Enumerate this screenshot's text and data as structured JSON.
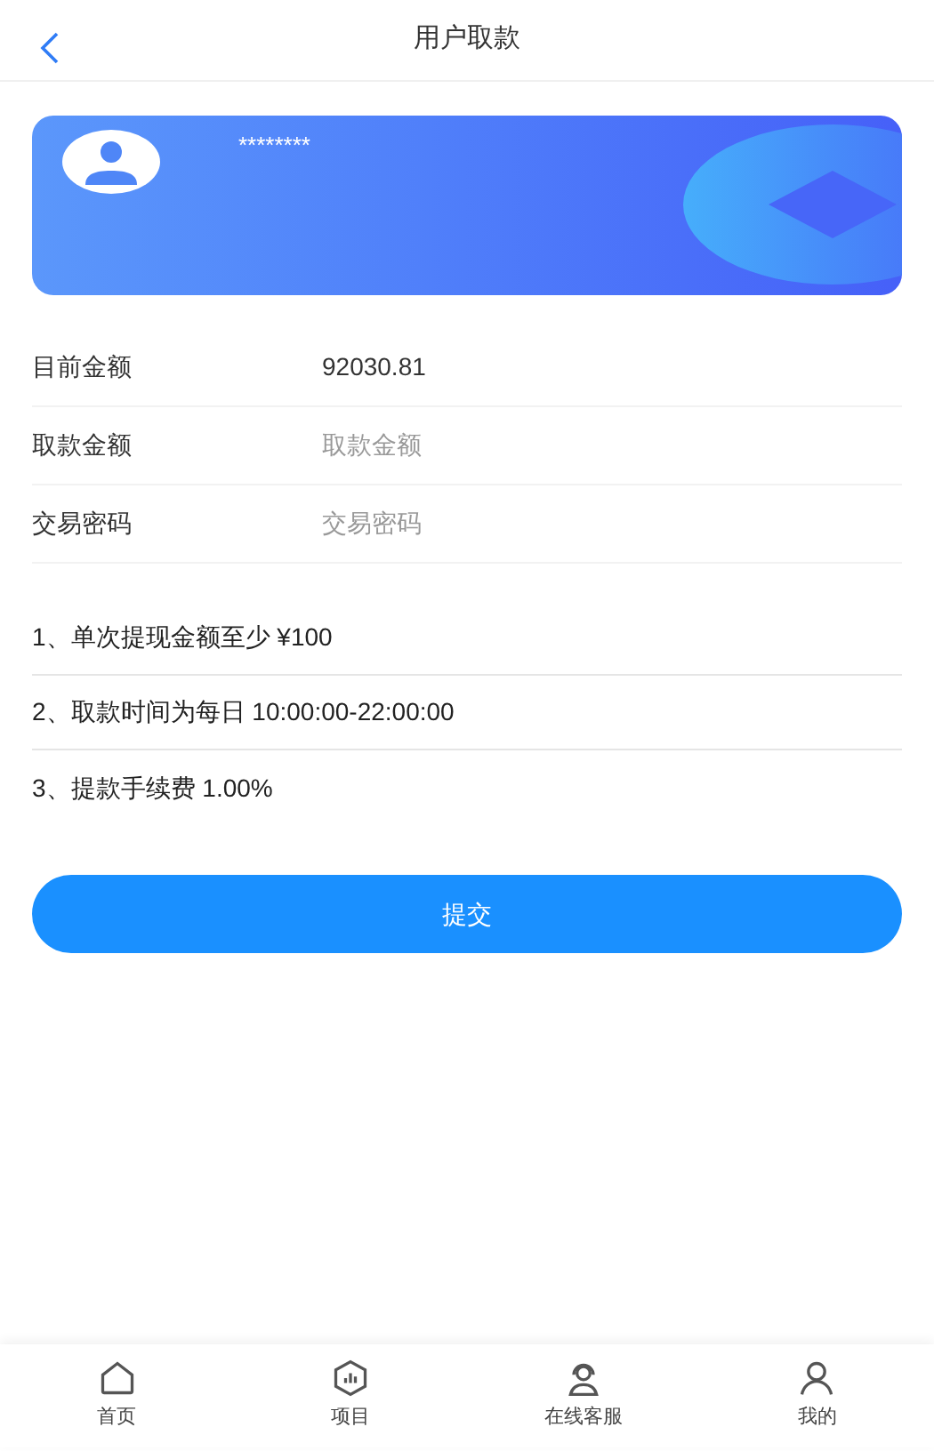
{
  "header": {
    "title": "用户取款"
  },
  "card": {
    "account": "********"
  },
  "form": [
    {
      "kind": "text",
      "label": "目前金额",
      "value": "92030.81"
    },
    {
      "kind": "input",
      "label": "取款金额",
      "placeholder": "取款金额"
    },
    {
      "kind": "input",
      "label": "交易密码",
      "placeholder": "交易密码"
    }
  ],
  "notes": [
    "1、单次提现金额至少 ¥100",
    "2、取款时间为每日 10:00:00-22:00:00",
    "3、提款手续费 1.00%"
  ],
  "submit": "提交",
  "tabbar": [
    {
      "kind": "home",
      "label": "首页"
    },
    {
      "kind": "project",
      "label": "项目"
    },
    {
      "kind": "support",
      "label": "在线客服"
    },
    {
      "kind": "me",
      "label": "我的"
    }
  ]
}
